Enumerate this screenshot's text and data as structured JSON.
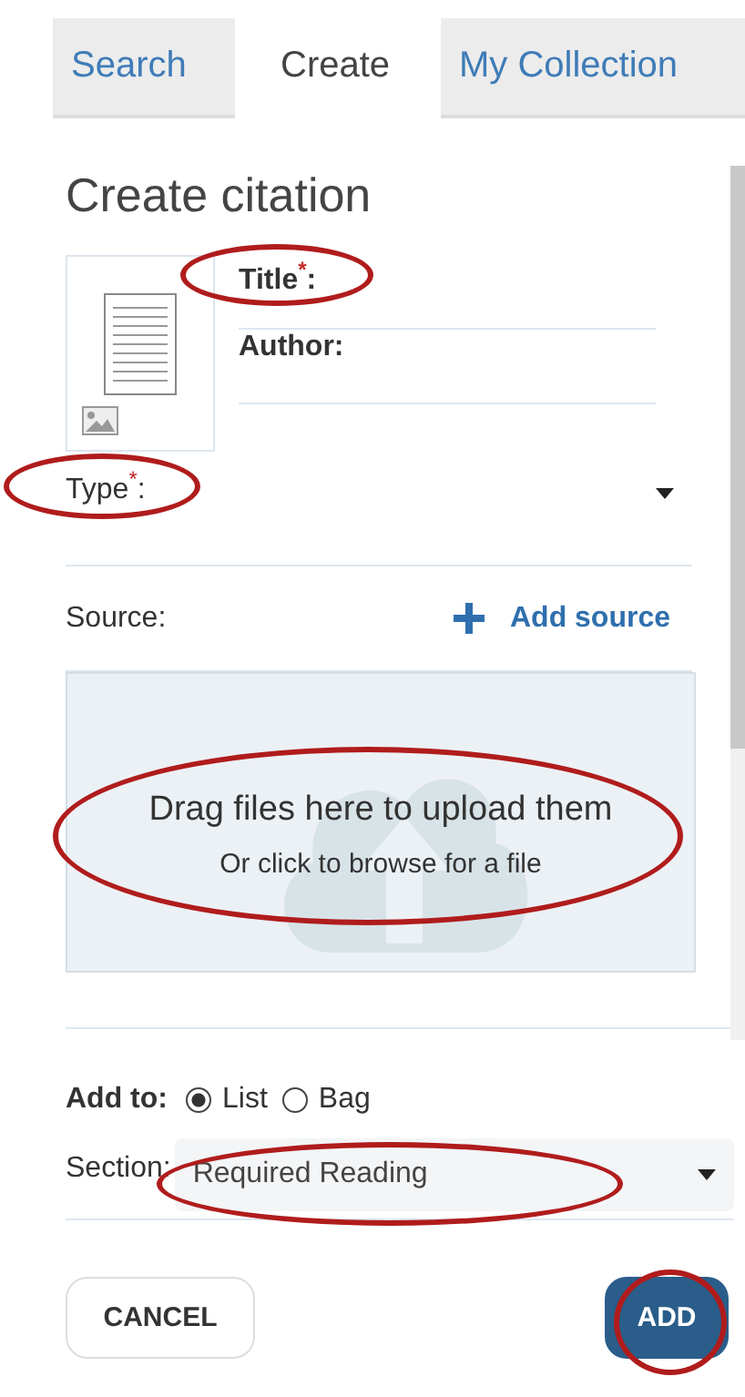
{
  "tabs": [
    {
      "label": "Search",
      "selected": false
    },
    {
      "label": "Create",
      "selected": true
    },
    {
      "label": "My Collection",
      "selected": false
    }
  ],
  "heading": "Create citation",
  "fields": [
    {
      "label": "Title$^{*}$:",
      "highlighted": true
    },
    {
      "label": "Author:",
      "highlighted": false
    }
  ],
  "type_field": {
    "label": "Type$^{*}$:",
    "highlighted": true
  },
  "source": {
    "label": "Source:",
    "action": "Add source"
  },
  "upload": {
    "title": "Drag files here to upload them",
    "subtitle": "Or click to browse for a file",
    "highlighted": true
  },
  "add_to": {
    "label": "Add to:",
    "options": [
      {
        "label": "List",
        "selected": true
      },
      {
        "label": "Bag",
        "selected": false
      }
    ]
  },
  "section": {
    "label": "Section:",
    "value": "Required Reading",
    "highlighted": true
  },
  "buttons": [
    {
      "kind": "secondary",
      "label": "CANCEL",
      "highlighted": false
    },
    {
      "kind": "primary",
      "label": "ADD",
      "highlighted": true
    }
  ]
}
